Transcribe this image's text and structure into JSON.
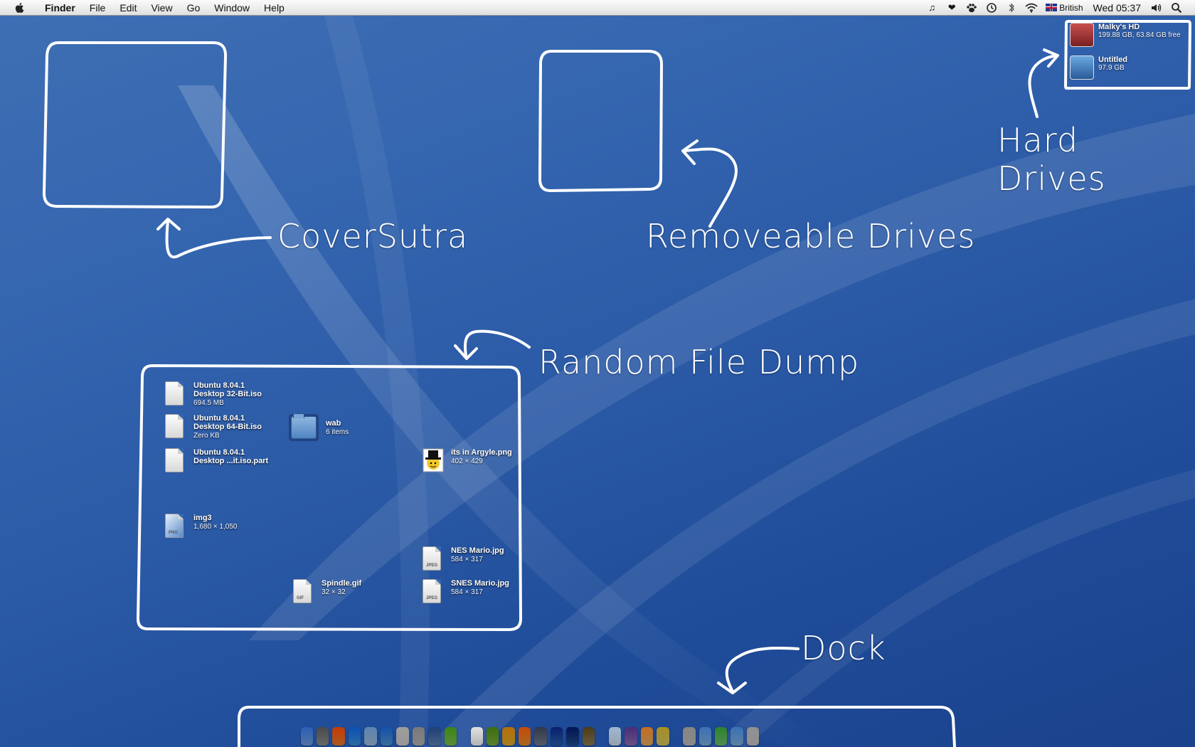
{
  "menubar": {
    "finder": "Finder",
    "items": [
      "File",
      "Edit",
      "View",
      "Go",
      "Window",
      "Help"
    ],
    "language": "British",
    "clock": "Wed 05:37",
    "status_icons": [
      "music-note-icon",
      "heart-icon",
      "paw-icon",
      "time-machine-icon",
      "bluetooth-icon",
      "wifi-icon",
      "flag-uk-icon",
      "volume-icon",
      "spotlight-icon"
    ]
  },
  "annotations": {
    "coversutra": "CoverSutra",
    "removeable": "Removeable Drives",
    "hard_drives": "Hard Drives",
    "random": "Random File Dump",
    "dock": "Dock"
  },
  "drives": [
    {
      "name": "Malky's HD",
      "info": "199.88 GB, 63.84 GB free",
      "color": "#a03a3a"
    },
    {
      "name": "Untitled",
      "info": "97.9 GB",
      "color": "#3a7ab0"
    }
  ],
  "files": {
    "ubuntu32": {
      "name": "Ubuntu 8.04.1\nDesktop 32-Bit.iso",
      "info": "694.5 MB"
    },
    "ubuntu64": {
      "name": "Ubuntu 8.04.1\nDesktop 64-Bit.iso",
      "info": "Zero KB"
    },
    "ubuntupart": {
      "name": "Ubuntu 8.04.1\nDesktop ...it.iso.part",
      "info": ""
    },
    "wab": {
      "name": "wab",
      "info": "6 items"
    },
    "argyle": {
      "name": "its in Argyle.png",
      "info": "402 × 429"
    },
    "img3": {
      "name": "img3",
      "info": "1,680 × 1,050",
      "tag": "PNG"
    },
    "nes": {
      "name": "NES Mario.jpg",
      "info": "584 × 317",
      "tag": "JPEG"
    },
    "spindle": {
      "name": "Spindle.gif",
      "info": "32 × 32",
      "tag": "GIF"
    },
    "snes": {
      "name": "SNES Mario.jpg",
      "info": "584 × 317",
      "tag": "JPEG"
    }
  },
  "dock": {
    "apps": [
      {
        "name": "finder-icon",
        "color": "#6b9bd8"
      },
      {
        "name": "system-preferences-icon",
        "color": "#8a8a8a"
      },
      {
        "name": "firefox-icon",
        "color": "#e07a2a"
      },
      {
        "name": "safari-icon",
        "color": "#3b8fd6"
      },
      {
        "name": "itunes-icon",
        "color": "#9ab8d6"
      },
      {
        "name": "quicktime-icon",
        "color": "#4b90d0"
      },
      {
        "name": "guitar-icon",
        "color": "#c9c9c9"
      },
      {
        "name": "pencil-icon",
        "color": "#b0b0b0"
      },
      {
        "name": "preview-icon",
        "color": "#5b7fb0"
      },
      {
        "name": "adium-icon",
        "color": "#7ab84a"
      }
    ],
    "docs": [
      {
        "name": "pdf-icon",
        "color": "#f0f0f0"
      },
      {
        "name": "green-app-icon",
        "color": "#7aa83a"
      },
      {
        "name": "yellow-app-icon",
        "color": "#d8a82a"
      },
      {
        "name": "orange-app-icon",
        "color": "#e08a2a"
      },
      {
        "name": "gray-app-icon",
        "color": "#707888"
      },
      {
        "name": "blue-app-icon",
        "color": "#2a5aa8"
      },
      {
        "name": "navy-app-icon",
        "color": "#1e4a90"
      },
      {
        "name": "tan-app-icon",
        "color": "#8a7a50"
      }
    ],
    "utilities": [
      {
        "name": "mail-icon",
        "color": "#c8d8e8"
      },
      {
        "name": "orb-icon",
        "color": "#8a6ab0"
      },
      {
        "name": "presentation-icon",
        "color": "#e0a860"
      },
      {
        "name": "chart-app-icon",
        "color": "#d0c060"
      }
    ],
    "stacks": [
      {
        "name": "utility-icon",
        "color": "#b8b8b8"
      },
      {
        "name": "applications-folder-icon",
        "color": "#7aaad8"
      },
      {
        "name": "downloads-folder-icon",
        "color": "#6ab86a"
      },
      {
        "name": "documents-folder-icon",
        "color": "#7aaad8"
      },
      {
        "name": "trash-icon",
        "color": "#c0c0c0"
      }
    ]
  }
}
